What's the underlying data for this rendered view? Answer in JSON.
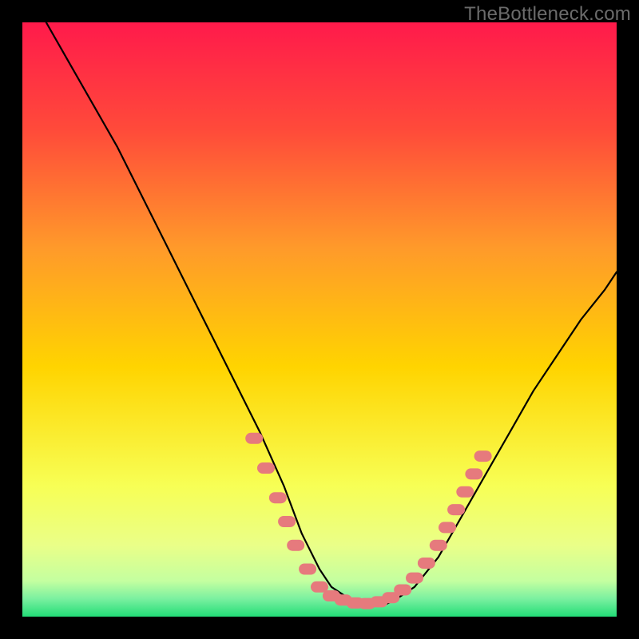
{
  "watermark": "TheBottleneck.com",
  "colors": {
    "background": "#000000",
    "curve": "#000000",
    "marker_fill": "#e67a7d",
    "marker_stroke": "#c85a5d",
    "gradient_top": "#ff1a4b",
    "gradient_mid1": "#ff7a2a",
    "gradient_mid2": "#ffd400",
    "gradient_low1": "#f7ff66",
    "gradient_low2": "#d8ff88",
    "gradient_bottom": "#22dd77"
  },
  "chart_data": {
    "type": "line",
    "title": "",
    "xlabel": "",
    "ylabel": "",
    "xlim": [
      0,
      100
    ],
    "ylim": [
      0,
      100
    ],
    "series": [
      {
        "name": "curve",
        "x": [
          4,
          8,
          12,
          16,
          20,
          24,
          28,
          32,
          36,
          40,
          44,
          47,
          50,
          52,
          55,
          58,
          61,
          63,
          66,
          70,
          74,
          78,
          82,
          86,
          90,
          94,
          98,
          100
        ],
        "y": [
          100,
          93,
          86,
          79,
          71,
          63,
          55,
          47,
          39,
          31,
          22,
          14,
          8,
          5,
          3,
          2,
          2,
          3,
          5,
          10,
          17,
          24,
          31,
          38,
          44,
          50,
          55,
          58
        ]
      }
    ],
    "markers": [
      {
        "x": 39,
        "y": 30
      },
      {
        "x": 41,
        "y": 25
      },
      {
        "x": 43,
        "y": 20
      },
      {
        "x": 44.5,
        "y": 16
      },
      {
        "x": 46,
        "y": 12
      },
      {
        "x": 48,
        "y": 8
      },
      {
        "x": 50,
        "y": 5
      },
      {
        "x": 52,
        "y": 3.5
      },
      {
        "x": 54,
        "y": 2.8
      },
      {
        "x": 56,
        "y": 2.3
      },
      {
        "x": 58,
        "y": 2.2
      },
      {
        "x": 60,
        "y": 2.5
      },
      {
        "x": 62,
        "y": 3.2
      },
      {
        "x": 64,
        "y": 4.5
      },
      {
        "x": 66,
        "y": 6.5
      },
      {
        "x": 68,
        "y": 9
      },
      {
        "x": 70,
        "y": 12
      },
      {
        "x": 71.5,
        "y": 15
      },
      {
        "x": 73,
        "y": 18
      },
      {
        "x": 74.5,
        "y": 21
      },
      {
        "x": 76,
        "y": 24
      },
      {
        "x": 77.5,
        "y": 27
      }
    ]
  }
}
